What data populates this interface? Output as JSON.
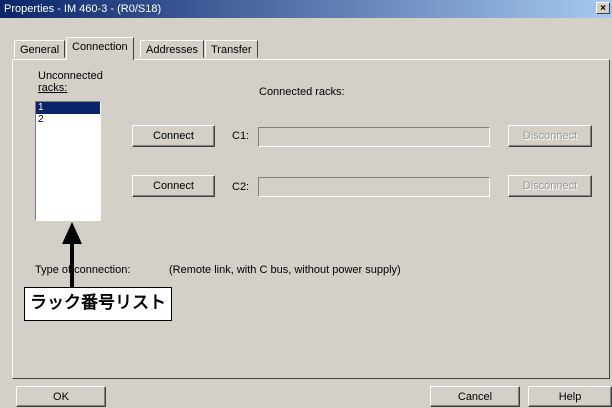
{
  "window": {
    "title": "Properties - IM 460-3 - (R0/S18)",
    "close_glyph": "×"
  },
  "tabs": [
    {
      "label": "General"
    },
    {
      "label": "Connection"
    },
    {
      "label": "Addresses"
    },
    {
      "label": "Transfer"
    }
  ],
  "connection": {
    "unconnected_label_line1": "Unconnected",
    "unconnected_label_line2": "racks:",
    "connected_label": "Connected racks:",
    "rack_list": [
      "1",
      "2"
    ],
    "selected_rack": "1",
    "row1": {
      "connect_label": "Connect",
      "slot_label": "C1:",
      "value": "",
      "disconnect_label": "Disconnect"
    },
    "row2": {
      "connect_label": "Connect",
      "slot_label": "C2:",
      "value": "",
      "disconnect_label": "Disconnect"
    },
    "type_label": "Type of connection:",
    "type_value": "(Remote link, with C bus, without power supply)"
  },
  "callout": {
    "text": "ラック番号リスト"
  },
  "footer": {
    "ok_label": "OK",
    "cancel_label": "Cancel",
    "help_label": "Help"
  }
}
